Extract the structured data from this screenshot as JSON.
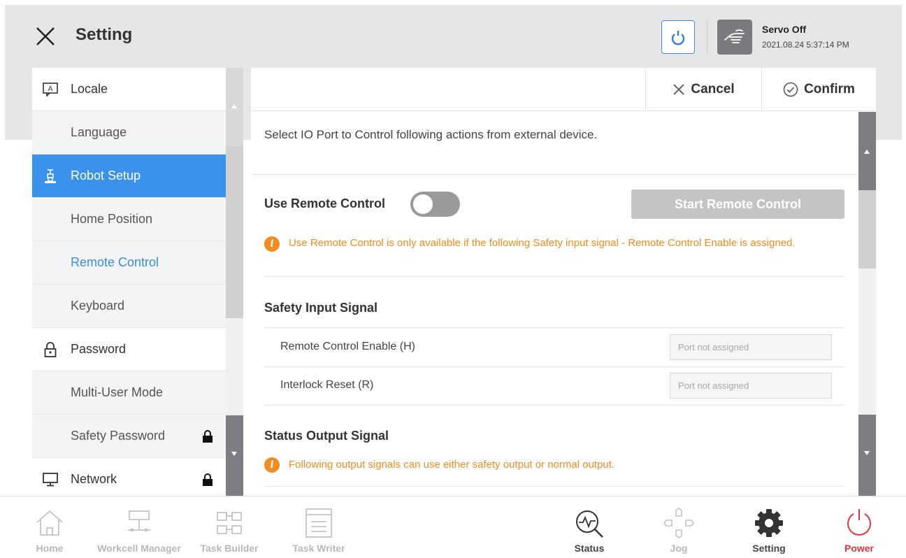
{
  "header": {
    "title": "Setting",
    "servo_status": "Servo Off",
    "datetime": "2021.08.24 5:37:14 PM"
  },
  "sidebar": {
    "items": [
      {
        "label": "Locale",
        "icon": "locale-icon",
        "type": "group"
      },
      {
        "label": "Language",
        "type": "sub"
      },
      {
        "label": "Robot Setup",
        "icon": "robot-icon",
        "type": "group",
        "active": true
      },
      {
        "label": "Home Position",
        "type": "sub"
      },
      {
        "label": "Remote Control",
        "type": "sub",
        "selected": true
      },
      {
        "label": "Keyboard",
        "type": "sub"
      },
      {
        "label": "Password",
        "icon": "lock-icon",
        "type": "group"
      },
      {
        "label": "Multi-User Mode",
        "type": "sub"
      },
      {
        "label": "Safety Password",
        "type": "sub",
        "locked": true
      },
      {
        "label": "Network",
        "icon": "monitor-icon",
        "type": "group",
        "locked": true
      }
    ]
  },
  "toolbar": {
    "cancel_label": "Cancel",
    "confirm_label": "Confirm"
  },
  "content": {
    "description": "Select IO Port to Control following actions from external device.",
    "use_remote_label": "Use Remote Control",
    "use_remote_on": false,
    "start_button": "Start Remote Control",
    "remote_warning": "Use Remote Control is only available if the following Safety input signal - Remote Control Enable is assigned.",
    "safety_input_title": "Safety Input Signal",
    "safety_inputs": [
      {
        "label": "Remote Control Enable (H)",
        "placeholder": "Port not assigned"
      },
      {
        "label": "Interlock Reset (R)",
        "placeholder": "Port not assigned"
      }
    ],
    "status_output_title": "Status Output Signal",
    "status_warning": "Following output signals can use either safety output or normal output."
  },
  "bottom_nav": [
    {
      "label": "Home",
      "icon": "home-icon"
    },
    {
      "label": "Workcell Manager",
      "icon": "workcell-icon"
    },
    {
      "label": "Task Builder",
      "icon": "task-builder-icon"
    },
    {
      "label": "Task Writer",
      "icon": "task-writer-icon"
    },
    {
      "label": "Status",
      "icon": "status-icon"
    },
    {
      "label": "Jog",
      "icon": "jog-icon"
    },
    {
      "label": "Setting",
      "icon": "gear-icon"
    },
    {
      "label": "Power",
      "icon": "power-icon"
    }
  ],
  "colors": {
    "accent": "#3b92ec",
    "warning": "#f28c1e",
    "power": "#e8323c"
  }
}
